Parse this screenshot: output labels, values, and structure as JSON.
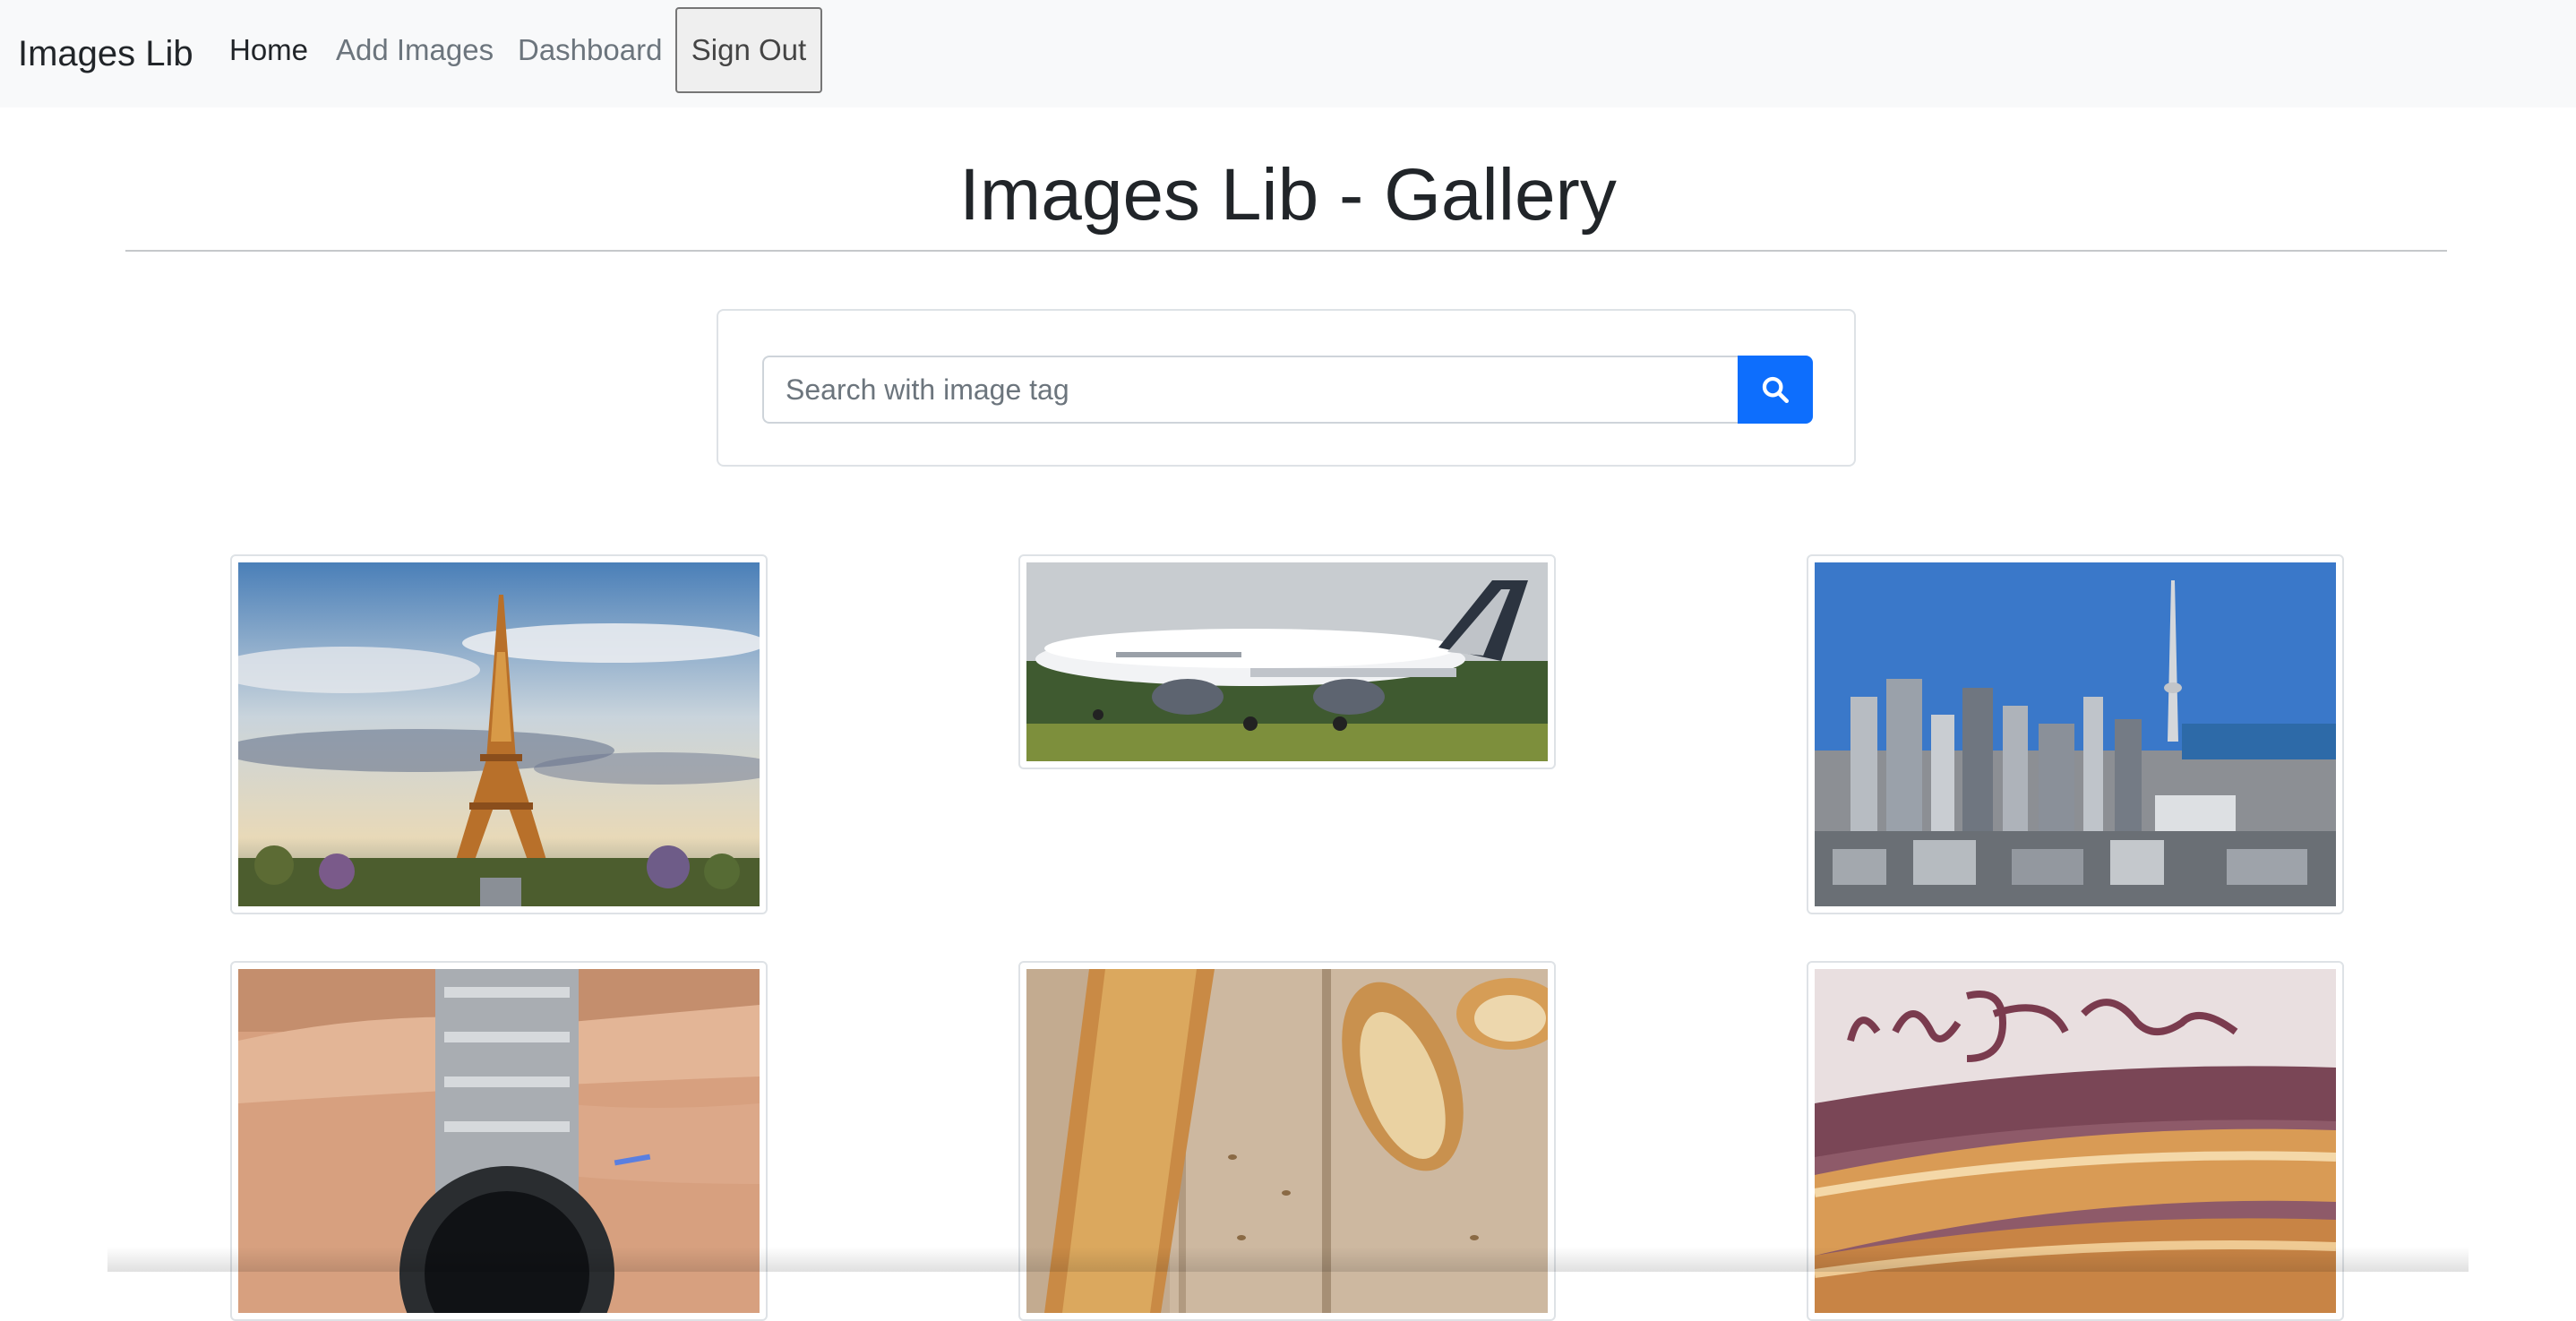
{
  "navbar": {
    "brand": "Images Lib",
    "links": [
      {
        "label": "Home",
        "active": true
      },
      {
        "label": "Add Images",
        "active": false
      },
      {
        "label": "Dashboard",
        "active": false
      }
    ],
    "signout_label": "Sign Out"
  },
  "page": {
    "title": "Images Lib - Gallery"
  },
  "search": {
    "placeholder": "Search with image tag",
    "value": "",
    "button_icon": "search-icon",
    "button_color": "#0d6efd"
  },
  "gallery": {
    "images": [
      {
        "subject": "eiffel-tower"
      },
      {
        "subject": "airbus-a350-airplane"
      },
      {
        "subject": "toronto-skyline"
      },
      {
        "subject": "wristwatch"
      },
      {
        "subject": "baguette-bread"
      },
      {
        "subject": "la-parisse-bread"
      }
    ]
  }
}
